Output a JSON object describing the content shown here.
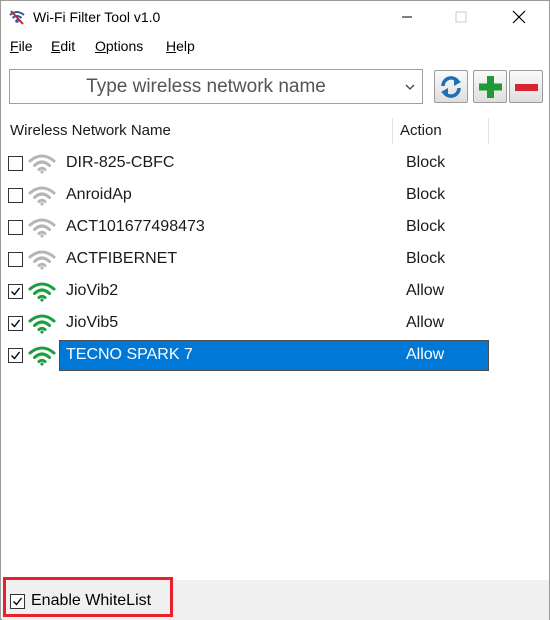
{
  "window": {
    "title": "Wi-Fi Filter Tool v1.0",
    "icon": "wifi-filter-app-icon",
    "controls": [
      "minimize-icon",
      "maximize-icon",
      "close-icon"
    ]
  },
  "menu": {
    "file": {
      "accel": "F",
      "rest": "ile"
    },
    "edit": {
      "accel": "E",
      "rest": "dit"
    },
    "options": {
      "accel": "O",
      "rest": "ptions"
    },
    "help": {
      "accel": "H",
      "rest": "elp"
    }
  },
  "toolbar": {
    "combo_text": "Type wireless network name",
    "refresh_icon": "refresh-icon",
    "add_icon": "plus-icon",
    "remove_icon": "minus-icon"
  },
  "list": {
    "columns": {
      "name": "Wireless Network Name",
      "action": "Action"
    },
    "rows": [
      {
        "checked": false,
        "signal": "inactive",
        "name": "DIR-825-CBFC",
        "action": "Block"
      },
      {
        "checked": false,
        "signal": "inactive",
        "name": "AnroidAp",
        "action": "Block"
      },
      {
        "checked": false,
        "signal": "inactive",
        "name": "ACT101677498473",
        "action": "Block"
      },
      {
        "checked": false,
        "signal": "inactive",
        "name": "ACTFIBERNET",
        "action": "Block"
      },
      {
        "checked": true,
        "signal": "active",
        "name": "JioVib2",
        "action": "Allow"
      },
      {
        "checked": true,
        "signal": "active",
        "name": "JioVib5",
        "action": "Allow"
      },
      {
        "checked": true,
        "signal": "active",
        "name": "TECNO SPARK 7",
        "action": "Allow",
        "selected": true
      }
    ]
  },
  "footer": {
    "whitelist_label": "Enable WhiteList",
    "whitelist_checked": true
  },
  "colors": {
    "selection": "#0078d7",
    "signal_active": "#1a9e3f",
    "signal_inactive": "#b5b5b5",
    "highlight_box": "#e8212d"
  }
}
